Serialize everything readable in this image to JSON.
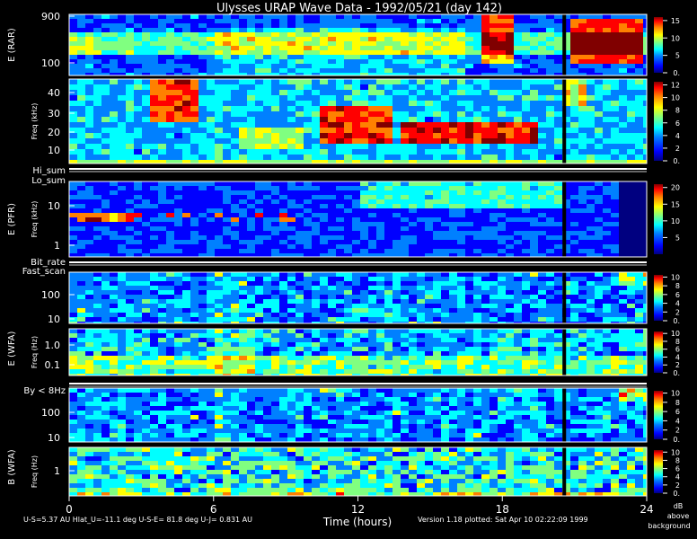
{
  "chart_data": {
    "type": "heatmap",
    "title": "Ulysses URAP Wave Data - 1992/05/21  (day 142)",
    "xlabel": "Time (hours)",
    "xlim": [
      0,
      24
    ],
    "xticks": [
      "0",
      "6",
      "12",
      "18",
      "24"
    ],
    "version_note": "Version 1.18 plotted: Sat Apr 10 02:22:09 1999",
    "footer_left": "U-S=5.37 AU   Hlat_U=-11.1 deg   U-S-E= 81.8 deg   U-J= 0.831 AU",
    "colorbar_units": [
      "dB",
      "above",
      "background"
    ],
    "panels": [
      {
        "id": "rar-high",
        "group_label": "E (RAR)",
        "ylabel": "",
        "yticks": [
          "900",
          "100"
        ],
        "cbar_ticks": [
          "15",
          "10",
          "5",
          "0."
        ],
        "cbar_max": 16
      },
      {
        "id": "rar-low",
        "group_label": "",
        "ylabel": "Freq (kHz)",
        "yticks": [
          "40",
          "30",
          "20",
          "10"
        ],
        "cbar_ticks": [
          "12",
          "10",
          "8",
          "6",
          "4",
          "2",
          "0."
        ],
        "cbar_max": 12.5
      },
      {
        "id": "pfr",
        "group_label": "E (PFR)",
        "ylabel": "Freq (kHz)",
        "yticks": [
          "10",
          "1"
        ],
        "cbar_ticks": [
          "20",
          "15",
          "10",
          "5"
        ],
        "cbar_max": 21
      },
      {
        "id": "wfa-e-high",
        "group_label": "E (WFA)",
        "ylabel": "",
        "yticks": [
          "100",
          "10"
        ],
        "cbar_ticks": [
          "10",
          "8",
          "6",
          "4",
          "2",
          "0."
        ],
        "cbar_max": 10.5
      },
      {
        "id": "wfa-e-low",
        "group_label": "",
        "ylabel": "Freq (Hz)",
        "yticks": [
          "1.0",
          "0.1"
        ],
        "cbar_ticks": [
          "10",
          "8",
          "6",
          "4",
          "2",
          "0."
        ],
        "cbar_max": 10.5
      },
      {
        "id": "wfa-b-high",
        "group_label": "B (WFA)",
        "ylabel": "",
        "yticks": [
          "100",
          "10"
        ],
        "cbar_ticks": [
          "10",
          "8",
          "6",
          "4",
          "2",
          "0."
        ],
        "cbar_max": 10.5
      },
      {
        "id": "wfa-b-low",
        "group_label": "",
        "ylabel": "Freq (Hz)",
        "yticks": [
          "1"
        ],
        "cbar_ticks": [
          "10",
          "8",
          "6",
          "4",
          "2",
          "0."
        ],
        "cbar_max": 10.5
      }
    ],
    "strips": [
      {
        "id": "hi-lo-sum",
        "labels": [
          "Hi_sum",
          "Lo_sum"
        ]
      },
      {
        "id": "bit-rate-fast-scan",
        "labels": [
          "Bit_rate",
          "Fast_scan"
        ]
      },
      {
        "id": "by-8hz",
        "labels": [
          "By < 8Hz"
        ]
      }
    ]
  },
  "colors": {
    "background": "#000000",
    "colormap": [
      "#000080",
      "#0000ff",
      "#0080ff",
      "#00ffff",
      "#80ff80",
      "#ffff00",
      "#ff8000",
      "#ff0000",
      "#800000"
    ]
  }
}
